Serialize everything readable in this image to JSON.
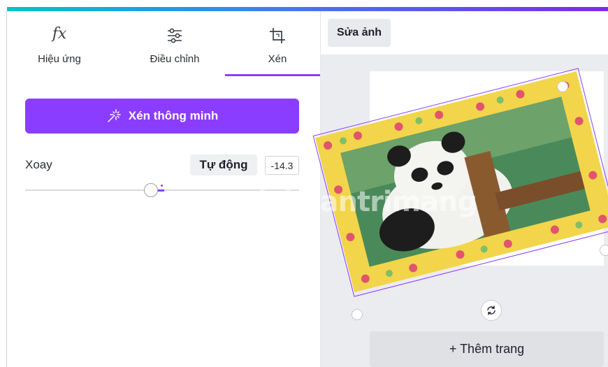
{
  "tabs": [
    {
      "label": "Hiệu ứng",
      "icon": "fx-icon",
      "active": false
    },
    {
      "label": "Điều chỉnh",
      "icon": "sliders-icon",
      "active": false
    },
    {
      "label": "Xén",
      "icon": "crop-icon",
      "active": true
    }
  ],
  "fx_glyph": "fx",
  "smart_crop": {
    "label": "Xén thông minh",
    "icon": "magic-wand-icon"
  },
  "rotate": {
    "label": "Xoay",
    "auto_label": "Tự động",
    "value": "-14.3"
  },
  "edit_button": "Sửa ảnh",
  "add_page": "+ Thêm trang",
  "watermark": {
    "text": "uantrimang"
  },
  "colors": {
    "accent": "#8b3dff",
    "canvas": "#ebecf0",
    "frame": "#f2d54a"
  }
}
